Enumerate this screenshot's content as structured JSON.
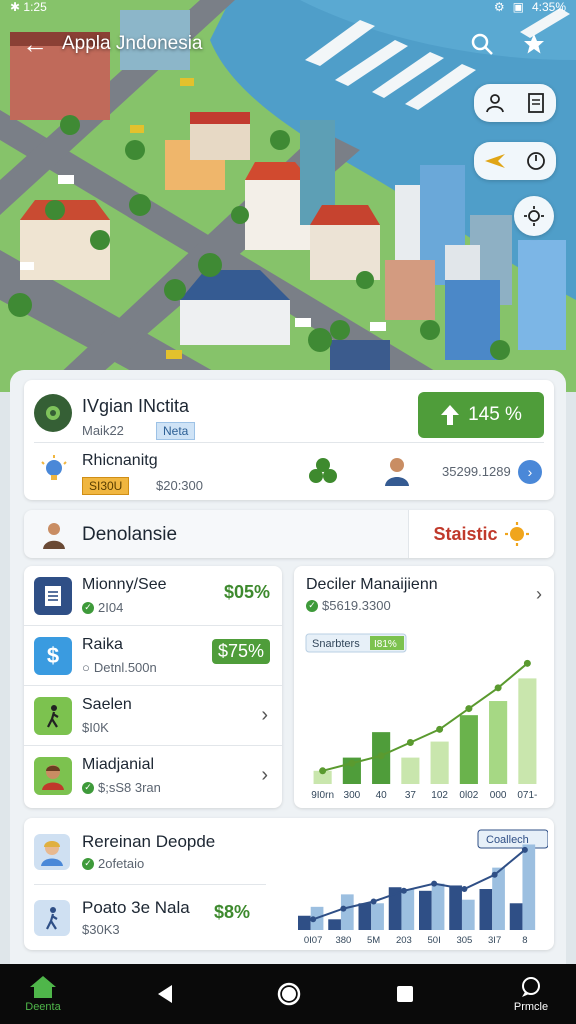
{
  "status_bar": {
    "left": "✱ 1:25",
    "battery": "4:35%"
  },
  "app_bar": {
    "title": "Appla Jndonesia"
  },
  "header": {
    "title": "IVgian INctita",
    "subtitle": "Maik22",
    "tag": "Neta",
    "growth": "145 %"
  },
  "summary_row": {
    "title": "Rhicnanitg",
    "chip": "SI30U",
    "amount": "$20:300",
    "value": "35299.1289"
  },
  "section": {
    "title": "Denolansie",
    "stat_label": "Staistic"
  },
  "list": [
    {
      "title": "Mionny/See",
      "sub": "2I04",
      "pct": "$05%"
    },
    {
      "title": "Raika",
      "sub": "Detnl.500n",
      "pct": "$75%"
    },
    {
      "title": "Saelen",
      "sub": "$I0K"
    },
    {
      "title": "Miadjanial",
      "sub": "$;sS8 3ran"
    }
  ],
  "chart_card": {
    "title": "Deciler Manaijienn",
    "sub": "$5619.3300"
  },
  "bottom": {
    "row1": {
      "title": "Rereinan Deopde",
      "sub": "2ofetaio"
    },
    "row2": {
      "title": "Poato 3e Nala",
      "sub": "$30K3",
      "pct": "$8%"
    }
  },
  "nav": {
    "home": "Deenta",
    "profile": "Prmcle"
  },
  "chart_data": [
    {
      "type": "bar",
      "legend": "Snarbters",
      "legend_value": "I81%",
      "categories": [
        "9I0rn",
        "300",
        "40",
        "37",
        "102",
        "0l02",
        "000",
        "071-"
      ],
      "values": [
        14,
        28,
        55,
        28,
        45,
        73,
        88,
        112
      ],
      "line": [
        14,
        22,
        30,
        44,
        58,
        80,
        102,
        128
      ],
      "ylim": [
        0,
        140
      ]
    },
    {
      "type": "bar",
      "legend": "Coallech",
      "categories": [
        "0I07",
        "380",
        "5M",
        "203",
        "50I",
        "305",
        "3I7",
        "8"
      ],
      "series": [
        {
          "values": [
            16,
            12,
            30,
            48,
            44,
            50,
            46,
            30
          ]
        },
        {
          "values": [
            26,
            40,
            30,
            46,
            52,
            34,
            70,
            96
          ]
        }
      ],
      "line": [
        12,
        24,
        32,
        44,
        52,
        46,
        62,
        90
      ],
      "ylim": [
        0,
        110
      ]
    }
  ],
  "colors": {
    "accent_green": "#4f9d3a",
    "link_blue": "#4a88d8",
    "stat_red": "#c0392b"
  }
}
